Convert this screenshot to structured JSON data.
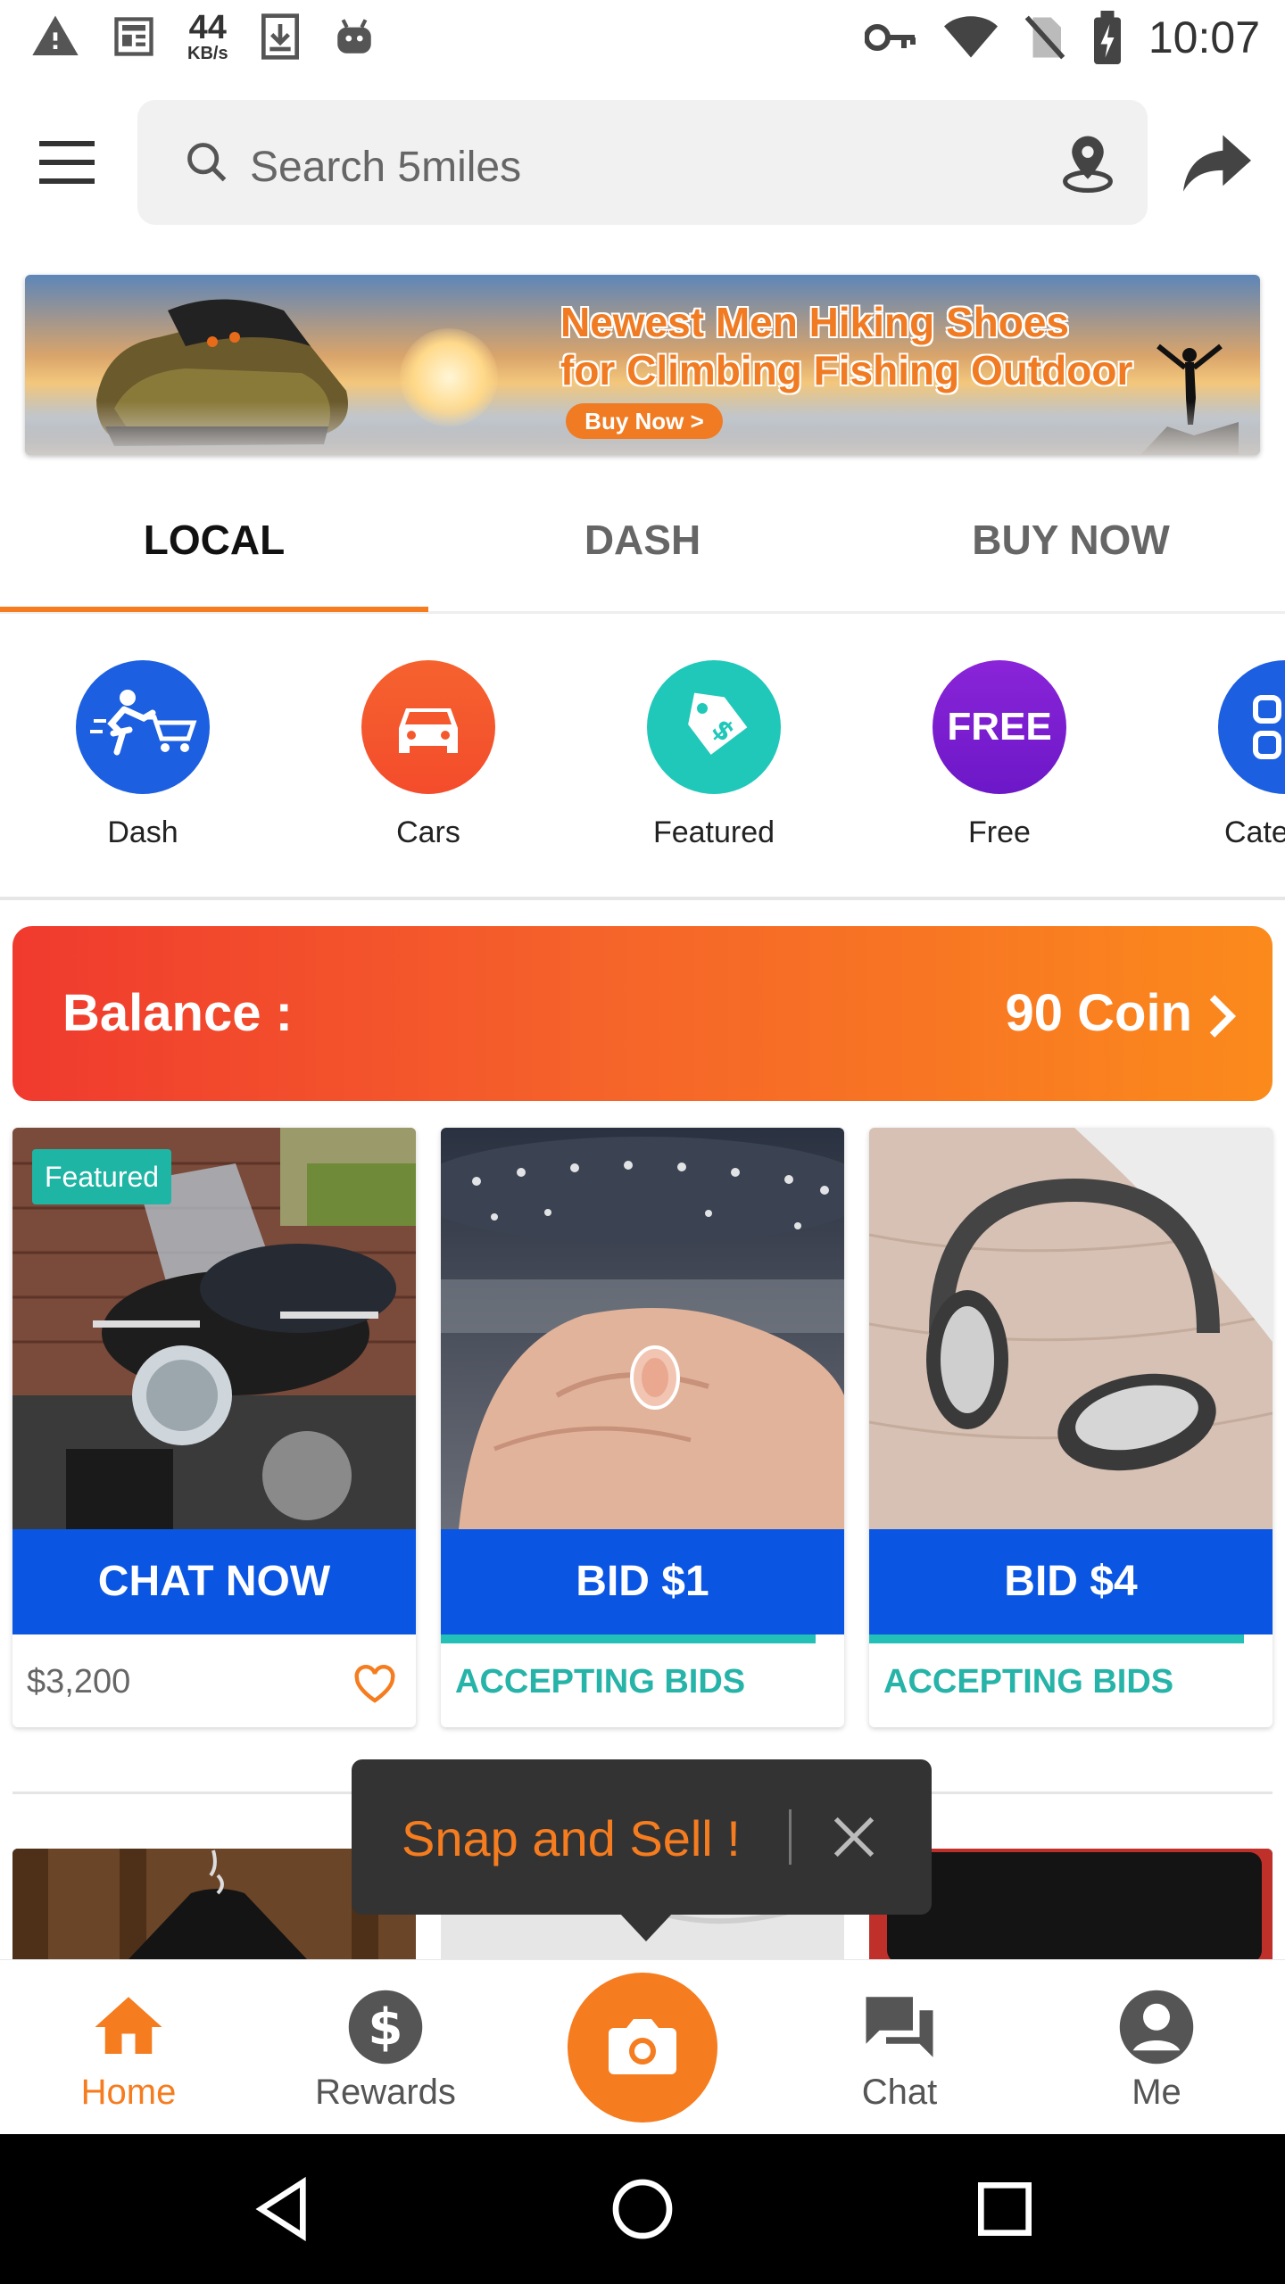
{
  "status_bar": {
    "net_speed_value": "44",
    "net_speed_unit": "KB/s",
    "time": "10:07",
    "icons": [
      "warning-icon",
      "news-icon",
      "download-icon",
      "android-icon",
      "vpn-key-icon",
      "wifi-icon",
      "no-sim-icon",
      "battery-charging-icon"
    ]
  },
  "topbar": {
    "search_placeholder": "Search 5miles"
  },
  "banner": {
    "line1": "Newest Men Hiking Shoes",
    "line2": "for Climbing Fishing Outdoor",
    "cta": "Buy Now >"
  },
  "tabs": [
    {
      "label": "LOCAL",
      "active": true
    },
    {
      "label": "DASH",
      "active": false
    },
    {
      "label": "BUY NOW",
      "active": false
    }
  ],
  "categories": [
    {
      "label": "Dash",
      "color": "#1c5fe0",
      "icon": "dash-cart-icon"
    },
    {
      "label": "Cars",
      "color": "#f55a2e",
      "icon": "car-icon"
    },
    {
      "label": "Featured",
      "color": "#20c8b9",
      "icon": "price-tag-icon"
    },
    {
      "label": "Free",
      "color": "#7b1fd6",
      "icon": "free-icon",
      "icon_text": "FREE"
    },
    {
      "label": "Cate",
      "color": "#1c5fe0",
      "icon": "grid-icon"
    }
  ],
  "balance": {
    "label": "Balance :",
    "value": "90 Coin"
  },
  "products": [
    {
      "badge": "Featured",
      "button": "CHAT NOW",
      "footer": "$3,200",
      "footer_style": "price",
      "image": "motorcycle"
    },
    {
      "button": "BID $1",
      "footer": "ACCEPTING BIDS",
      "footer_style": "bids",
      "bid_progress": 0.93,
      "image": "ring"
    },
    {
      "button": "BID $4",
      "footer": "ACCEPTING BIDS",
      "footer_style": "bids",
      "bid_progress": 0.93,
      "image": "headphones"
    }
  ],
  "toast": {
    "text": "Snap and Sell !"
  },
  "bottom_nav": [
    {
      "label": "Home",
      "icon": "home-icon",
      "active": true
    },
    {
      "label": "Rewards",
      "icon": "dollar-icon",
      "active": false
    },
    {
      "label": "",
      "icon": "camera-icon",
      "active": false
    },
    {
      "label": "Chat",
      "icon": "chat-icon",
      "active": false
    },
    {
      "label": "Me",
      "icon": "person-icon",
      "active": false
    }
  ],
  "colors": {
    "accent": "#f57c1f",
    "primary_blue": "#0a56e2",
    "teal": "#26b3a8"
  }
}
